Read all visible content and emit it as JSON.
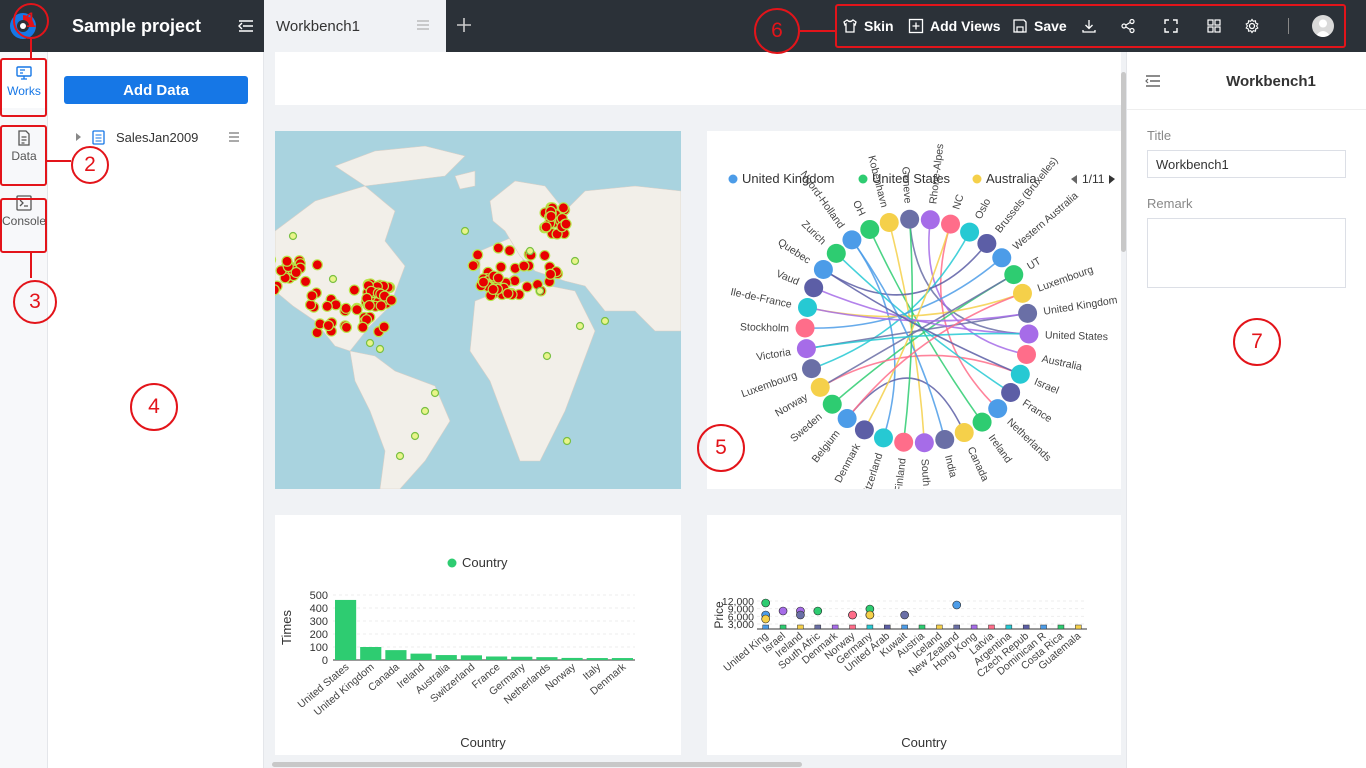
{
  "header": {
    "logo": "app-logo",
    "project_title": "Sample project",
    "collapse_icon": "collapse-menu-icon",
    "active_tab": "Workbench1",
    "add_tab_icon": "plus-icon",
    "toolbar": {
      "skin": "Skin",
      "add_views": "Add Views",
      "save": "Save",
      "download_icon": "download-icon",
      "share_icon": "share-icon",
      "fullscreen_icon": "fullscreen-icon",
      "layout_icon": "grid-icon",
      "settings_icon": "gear-icon",
      "avatar_icon": "user-avatar-icon"
    }
  },
  "nav": {
    "works": "Works",
    "data": "Data",
    "console": "Console"
  },
  "data_panel": {
    "add_data": "Add Data",
    "dataset": "SalesJan2009"
  },
  "right_panel": {
    "title": "Workbench1",
    "title_label": "Title",
    "title_value": "Workbench1",
    "remark_label": "Remark",
    "remark_value": ""
  },
  "annotations": [
    "1",
    "2",
    "3",
    "4",
    "5",
    "6",
    "7"
  ],
  "colors": {
    "accent": "#1677e6",
    "topbar": "#2b3138",
    "annotation": "#e3141a",
    "bar": "#2ecc71"
  },
  "chart_data": [
    {
      "type": "map",
      "note_points": "world map with clustered sales locations, densest in United States and Western Europe"
    },
    {
      "type": "chord",
      "legend": [
        "United Kingdom",
        "United States",
        "Australia"
      ],
      "legend_page": "1/11",
      "nodes": [
        "Noord-Holland",
        "OH",
        "Kobenhavn",
        "Geneve",
        "Rhone-Alpes",
        "NC",
        "Oslo",
        "Brussels (Bruxelles)",
        "Western Australia",
        "UT",
        "Luxembourg",
        "United Kingdom",
        "United States",
        "Australia",
        "Israel",
        "France",
        "Netherlands",
        "Ireland",
        "Canada",
        "India",
        "South Africa",
        "Finland",
        "Switzerland",
        "Denmark",
        "Belgium",
        "Sweden",
        "Norway",
        "Luxembourg",
        "Victoria",
        "Stockholm",
        "Ile-de-France",
        "Vaud",
        "Quebec",
        "Zurich"
      ]
    },
    {
      "type": "bar",
      "legend": [
        "Country"
      ],
      "categories": [
        "United States",
        "United Kingdom",
        "Canada",
        "Ireland",
        "Australia",
        "Switzerland",
        "France",
        "Germany",
        "Netherlands",
        "Norway",
        "Italy",
        "Denmark"
      ],
      "values": [
        462,
        100,
        76,
        49,
        38,
        36,
        27,
        25,
        22,
        16,
        15,
        15
      ],
      "xlabel": "Country",
      "ylabel": "Times",
      "ylim": [
        0,
        500
      ],
      "yticks": [
        "500",
        "400",
        "300",
        "200",
        "100",
        "0"
      ],
      "grid": true
    },
    {
      "type": "box",
      "categories": [
        "United King",
        "Israel",
        "Ireland",
        "South Afric",
        "Denmark",
        "Norway",
        "Germany",
        "United Arab",
        "Kuwait",
        "Austria",
        "Iceland",
        "New Zealand",
        "Hong Kong",
        "Latvia",
        "Argentina",
        "Czech Repub",
        "Dominican R",
        "Costa Rica",
        "Guatemala"
      ],
      "xlabel": "Country",
      "ylabel": "Price",
      "yticks": [
        "12,000",
        "9,000",
        "6,000",
        "3,000"
      ]
    }
  ]
}
